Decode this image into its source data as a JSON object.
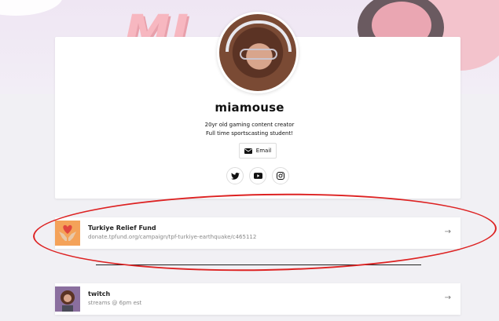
{
  "profile": {
    "username": "miamouse",
    "bio_line1": "20yr old gaming content creator",
    "bio_line2": "Full time sportscasting student!",
    "email_label": "Email"
  },
  "social": {
    "icons": [
      "twitter-icon",
      "youtube-icon",
      "instagram-icon"
    ]
  },
  "links": [
    {
      "title": "Turkiye Relief Fund",
      "subtitle": "donate.tpfund.org/campaign/tpf-turkiye-earthquake/c465112",
      "icon": "hands-heart-icon"
    },
    {
      "title": "twitch",
      "subtitle": "streams @ 6pm est",
      "icon": "avatar-thumbnail"
    }
  ],
  "colors": {
    "annotation": "#dd2222",
    "relief_thumb_bg": "#f4a259",
    "heart": "#e0463f"
  }
}
